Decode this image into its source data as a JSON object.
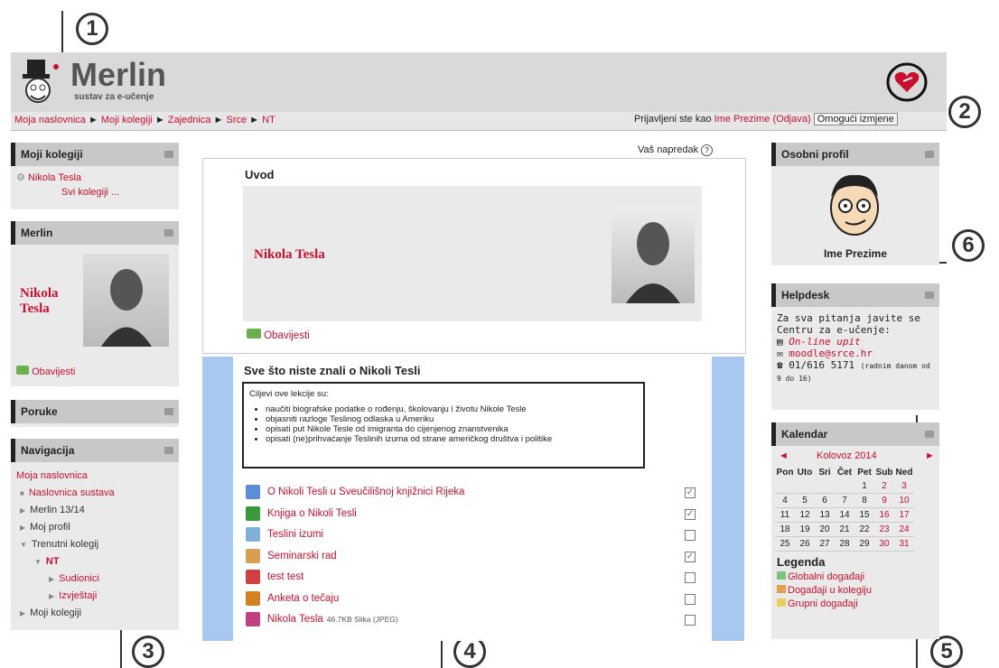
{
  "callouts": [
    "1",
    "2",
    "3",
    "4",
    "5",
    "6"
  ],
  "header": {
    "logo_title": "Merlin",
    "logo_subtitle": "sustav za e-učenje"
  },
  "breadcrumb": [
    "Moja naslovnica",
    "Moji kolegiji",
    "Zajednica",
    "Srce",
    "NT"
  ],
  "login": {
    "prefix": "Prijavljeni ste kao",
    "user": "Ime Prezime",
    "logout": "(Odjava)",
    "edit_button": "Omogući izmjene"
  },
  "left": {
    "courses": {
      "title": "Moji kolegiji",
      "item": "Nikola Tesla",
      "all": "Svi kolegiji ..."
    },
    "merlin": {
      "title": "Merlin",
      "name": "Nikola Tesla",
      "news": "Obavijesti"
    },
    "messages": {
      "title": "Poruke"
    },
    "nav": {
      "title": "Navigacija",
      "home": "Moja naslovnica",
      "items": [
        {
          "label": "Naslovnica sustava",
          "indent": 0,
          "marker": "■"
        },
        {
          "label": "Merlin 13/14",
          "indent": 0,
          "marker": "▶"
        },
        {
          "label": "Moj profil",
          "indent": 0,
          "marker": "▶"
        },
        {
          "label": "Trenutni kolegij",
          "indent": 0,
          "marker": "▼"
        },
        {
          "label": "NT",
          "indent": 1,
          "marker": "▼"
        },
        {
          "label": "Sudionici",
          "indent": 2,
          "marker": "▶"
        },
        {
          "label": "Izvještaji",
          "indent": 2,
          "marker": "▶"
        },
        {
          "label": "Moji kolegiji",
          "indent": 0,
          "marker": "▶"
        }
      ]
    }
  },
  "center": {
    "progress": "Vaš napredak",
    "progress_help": "?",
    "intro": {
      "title": "Uvod",
      "name": "Nikola Tesla",
      "news": "Obavijesti"
    },
    "topic": {
      "title": "Sve što niste znali o Nikoli Tesli",
      "goals_heading": "Ciljevi ove lekcije su:",
      "goals": [
        "naučiti biografske podatke o rođenju, školovanju i životu Nikole Tesle",
        "objasniti razloge Teslinog odlaska u Ameriku",
        "opisati put Nikole Tesle od imigranta do cijenjenog znanstvenika",
        "opisati (ne)prihvaćanje Teslinih izuma od strane američkog društva i politike"
      ],
      "activities": [
        {
          "label": "O Nikoli Tesli u Sveučilišnoj knjižnici Rijeka",
          "suffix": "",
          "color": "#5b8ed6",
          "checked": "✓"
        },
        {
          "label": "Knjiga o Nikoli Tesli",
          "suffix": "",
          "color": "#3a9a3a",
          "checked": "✓"
        },
        {
          "label": "Teslini izumi",
          "suffix": "",
          "color": "#7fb0d8",
          "checked": ""
        },
        {
          "label": "Seminarski rad",
          "suffix": "",
          "color": "#d6a050",
          "checked": "✓"
        },
        {
          "label": "test test",
          "suffix": "",
          "color": "#d04040",
          "checked": ""
        },
        {
          "label": "Anketa o tečaju",
          "suffix": "",
          "color": "#d68020",
          "checked": ""
        },
        {
          "label": "Nikola Tesla",
          "suffix": "46.7KB Slika (JPEG)",
          "color": "#c04080",
          "checked": ""
        }
      ]
    }
  },
  "right": {
    "profile": {
      "title": "Osobni profil",
      "name": "Ime Prezime"
    },
    "helpdesk": {
      "title": "Helpdesk",
      "text": "Za sva pitanja javite se Centru za e-učenje:",
      "online": "On-line upit",
      "email": "moodle@srce.hr",
      "phone": "01/616 5171",
      "hours": "(radnim danom od 9 do 16)"
    },
    "calendar": {
      "title": "Kalendar",
      "month": "Kolovoz 2014",
      "prev": "◄",
      "next": "►",
      "days": [
        "Pon",
        "Uto",
        "Sri",
        "Čet",
        "Pet",
        "Sub",
        "Ned"
      ],
      "weeks": [
        [
          "",
          "",
          "",
          "",
          "1",
          "2",
          "3"
        ],
        [
          "4",
          "5",
          "6",
          "7",
          "8",
          "9",
          "10"
        ],
        [
          "11",
          "12",
          "13",
          "14",
          "15",
          "16",
          "17"
        ],
        [
          "18",
          "19",
          "20",
          "21",
          "22",
          "23",
          "24"
        ],
        [
          "25",
          "26",
          "27",
          "28",
          "29",
          "30",
          "31"
        ]
      ],
      "legend_title": "Legenda",
      "legend": [
        {
          "label": "Globalni događaji",
          "color": "#7cc47c"
        },
        {
          "label": "Događaji u kolegiju",
          "color": "#e0a050"
        },
        {
          "label": "Grupni događaji",
          "color": "#e8d060"
        }
      ]
    }
  }
}
